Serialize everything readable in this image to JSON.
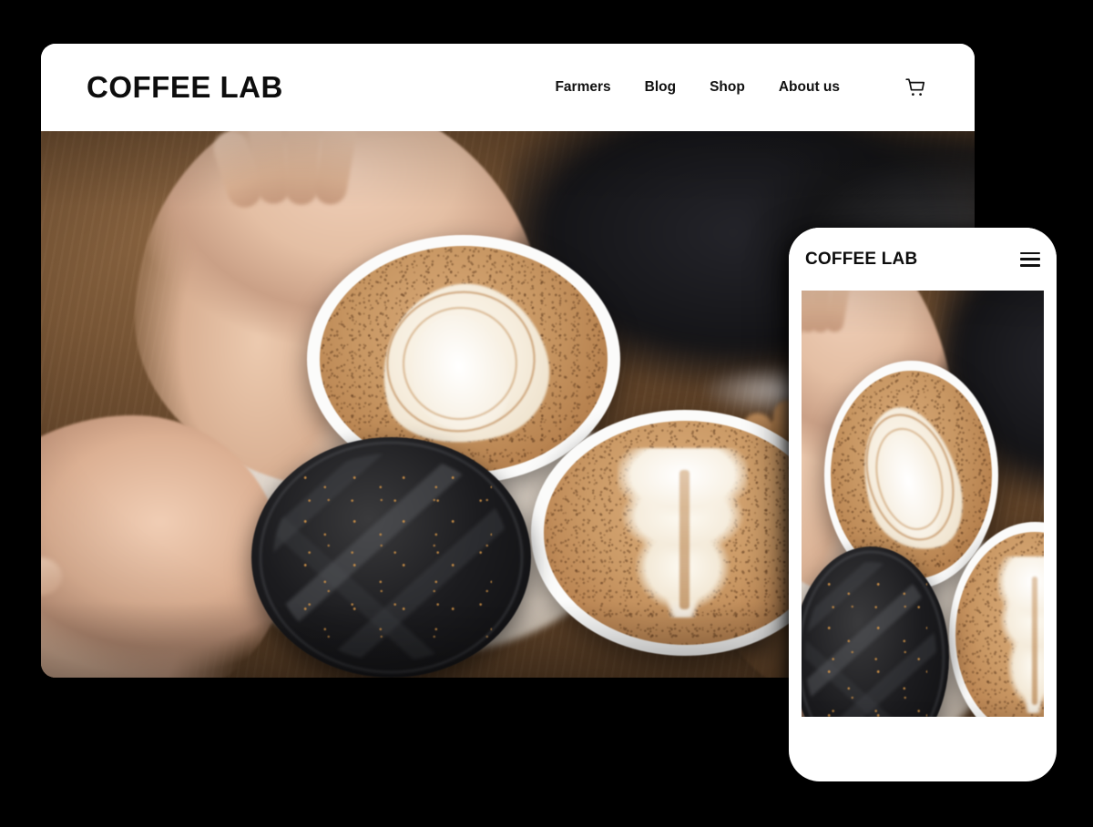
{
  "meta": {
    "background_color": "#000000",
    "brand_text_color": "#0d0d0d",
    "device_frame_color": "#ffffff"
  },
  "desktop": {
    "name": "desktop-browser-mockup",
    "header": {
      "logo": "COFFEE LAB",
      "nav_items": [
        {
          "label": "Farmers"
        },
        {
          "label": "Blog"
        },
        {
          "label": "Shop"
        },
        {
          "label": "About us"
        }
      ],
      "cart_icon": "shopping-cart-icon"
    },
    "hero": {
      "alt": "Three hands holding coffee cups together — two lattes with latte art and one iced black coffee, on a wooden table",
      "palette": {
        "wood": "#7a5a3e",
        "crema": "#c89763",
        "foam": "#fdfaf3",
        "dark_cup": "#1c1c1f",
        "cup_white": "#fbfbfa"
      }
    }
  },
  "mobile": {
    "name": "phone-mockup",
    "header": {
      "logo": "COFFEE LAB",
      "menu_icon": "hamburger-menu-icon"
    },
    "hero": {
      "alt": "Cropped view of the same coffee cups photo"
    }
  }
}
